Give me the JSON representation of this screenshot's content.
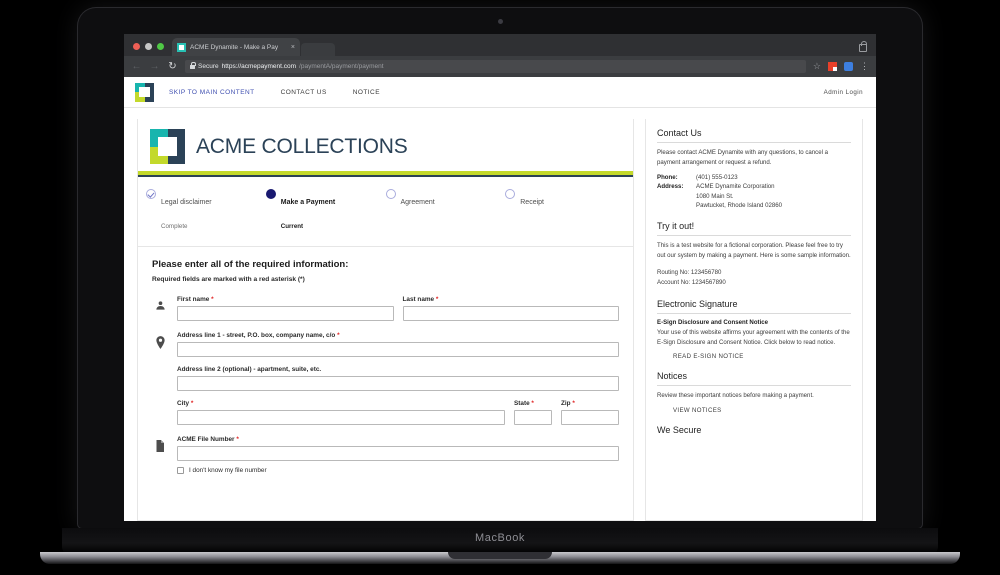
{
  "device": {
    "label": "MacBook"
  },
  "browser": {
    "tab": {
      "title": "ACME Dynamite - Make a Pay",
      "close": "×",
      "favicon_icon": "acme-favicon"
    },
    "toolbar": {
      "back_icon": "back-arrow-icon",
      "forward_icon": "forward-arrow-icon",
      "reload_icon": "reload-icon",
      "secure_label": "Secure",
      "url_origin": "https://acmepayment.com",
      "url_path": "/paymentA/payment/payment",
      "star_icon": "star-icon",
      "extension_red_icon": "extension-red-icon",
      "extension_blue_icon": "extension-blue-icon",
      "menu_icon": "three-dot-menu-icon",
      "lock_icon": "window-lock-icon"
    }
  },
  "site_nav": {
    "logo_icon": "acme-logo-icon",
    "links": [
      {
        "label": "SKIP TO MAIN CONTENT",
        "accent": true
      },
      {
        "label": "CONTACT US",
        "accent": false
      },
      {
        "label": "NOTICE",
        "accent": false
      }
    ],
    "admin_login": "Admin Login"
  },
  "brand": {
    "title": "ACME COLLECTIONS",
    "logo_icon": "acme-logo-icon",
    "colors": {
      "teal": "#18b5ae",
      "navy": "#2b4257",
      "lime": "#c3d92b",
      "rule_green": "#c3d92b",
      "rule_navy": "#2b4257",
      "current_step": "#191970",
      "required_asterisk": "#e02020",
      "link_accent": "#3f4fb0"
    }
  },
  "stepper": [
    {
      "label": "Legal disclaimer",
      "sub": "Complete",
      "state": "complete"
    },
    {
      "label": "Make a Payment",
      "sub": "Current",
      "state": "current"
    },
    {
      "label": "Agreement",
      "sub": "",
      "state": "pending"
    },
    {
      "label": "Receipt",
      "sub": "",
      "state": "pending"
    }
  ],
  "form": {
    "heading": "Please enter all of the required information:",
    "subheading": "Required fields are marked with a red asterisk (*)",
    "name_icon": "person-icon",
    "address_icon": "location-pin-icon",
    "file_icon": "document-icon",
    "fields": {
      "first_name": {
        "label": "First name",
        "required": true,
        "value": ""
      },
      "last_name": {
        "label": "Last name",
        "required": true,
        "value": ""
      },
      "address1": {
        "label": "Address line 1 - street, P.O. box, company name, c/o",
        "required": true,
        "value": ""
      },
      "address2": {
        "label": "Address line 2 (optional) - apartment, suite, etc.",
        "required": false,
        "value": ""
      },
      "city": {
        "label": "City",
        "required": true,
        "value": ""
      },
      "state": {
        "label": "State",
        "required": true,
        "value": ""
      },
      "zip": {
        "label": "Zip",
        "required": true,
        "value": ""
      },
      "file_number": {
        "label": "ACME File Number",
        "required": true,
        "value": ""
      }
    },
    "unknown_file_checkbox": {
      "label": "I don't know my file number",
      "checked": false
    }
  },
  "sidebar": {
    "contact": {
      "title": "Contact Us",
      "body": "Please contact ACME Dynamite with any questions, to cancel a payment arrangement or request a refund.",
      "phone_key": "Phone:",
      "phone_value": "(401) 555-0123",
      "address_key": "Address:",
      "address_line1": "ACME Dynamite Corporation",
      "address_line2": "1080 Main St.",
      "address_line3": "Pawtucket, Rhode Island 02860"
    },
    "try_it": {
      "title": "Try it out!",
      "body": "This is a test website for a fictional corporation. Please feel free to try out our system by making a payment. Here is some sample information.",
      "routing": "Routing No: 123456780",
      "account": "Account No: 1234567890"
    },
    "esign": {
      "title": "Electronic Signature",
      "subtitle": "E-Sign Disclosure and Consent Notice",
      "body": "Your use of this website affirms your agreement with the contents of the E-Sign Disclosure and Consent Notice. Click below to read notice.",
      "link": "READ E-SIGN NOTICE"
    },
    "notices": {
      "title": "Notices",
      "body": "Review these important notices before making a payment.",
      "link": "VIEW NOTICES"
    },
    "cut_off_title": "We Secure"
  }
}
